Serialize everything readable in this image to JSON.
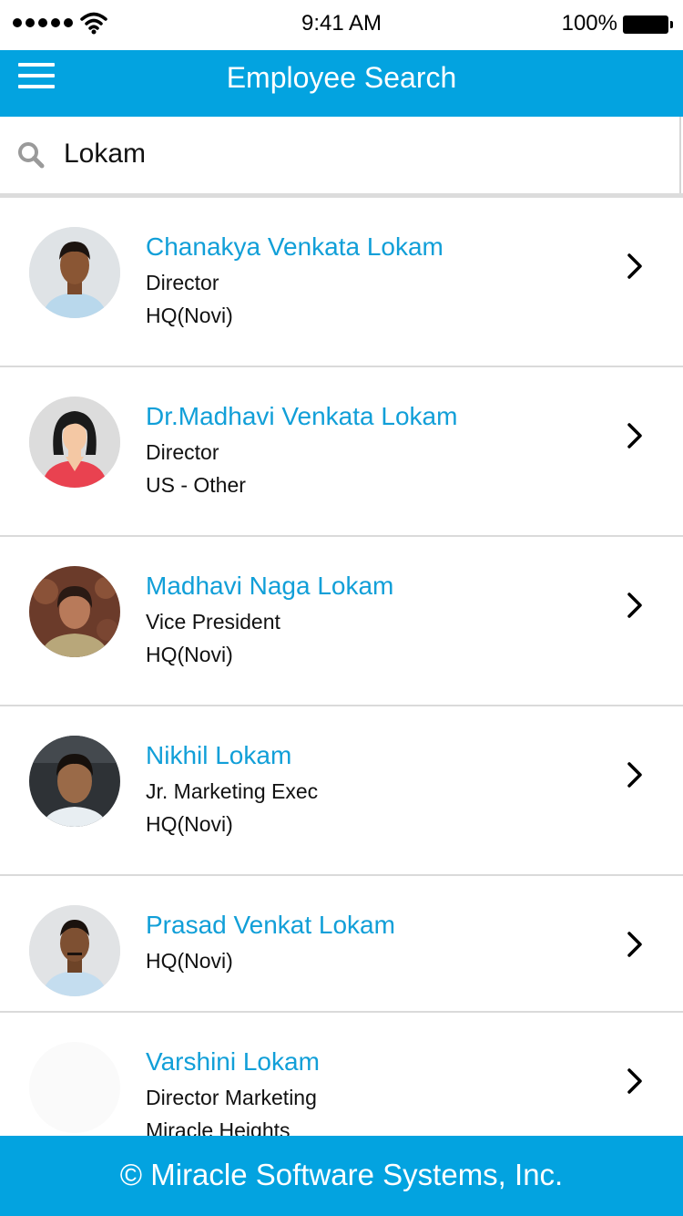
{
  "status_bar": {
    "time": "9:41 AM",
    "battery": "100%"
  },
  "header": {
    "title": "Employee Search",
    "menu_icon": "hamburger-menu-icon"
  },
  "search": {
    "icon": "search-icon",
    "value": "Lokam",
    "placeholder": ""
  },
  "employees": [
    {
      "name": "Chanakya Venkata Lokam",
      "line1": "Director",
      "line2": "HQ(Novi)",
      "avatar": "photo"
    },
    {
      "name": "Dr.Madhavi Venkata Lokam",
      "line1": "Director",
      "line2": "US - Other",
      "avatar": "female-placeholder"
    },
    {
      "name": "Madhavi Naga Lokam",
      "line1": "Vice President",
      "line2": "HQ(Novi)",
      "avatar": "photo"
    },
    {
      "name": "Nikhil Lokam",
      "line1": "Jr. Marketing Exec",
      "line2": "HQ(Novi)",
      "avatar": "photo"
    },
    {
      "name": "Prasad Venkat Lokam",
      "line1": "HQ(Novi)",
      "avatar": "photo"
    },
    {
      "name": "Varshini Lokam",
      "line1": "Director Marketing",
      "line2": "Miracle Heights",
      "avatar": "blank"
    }
  ],
  "footer": {
    "text": "© Miracle Software Systems, Inc."
  },
  "colors": {
    "brand_blue": "#03a3e0",
    "name_blue": "#119fd8"
  }
}
